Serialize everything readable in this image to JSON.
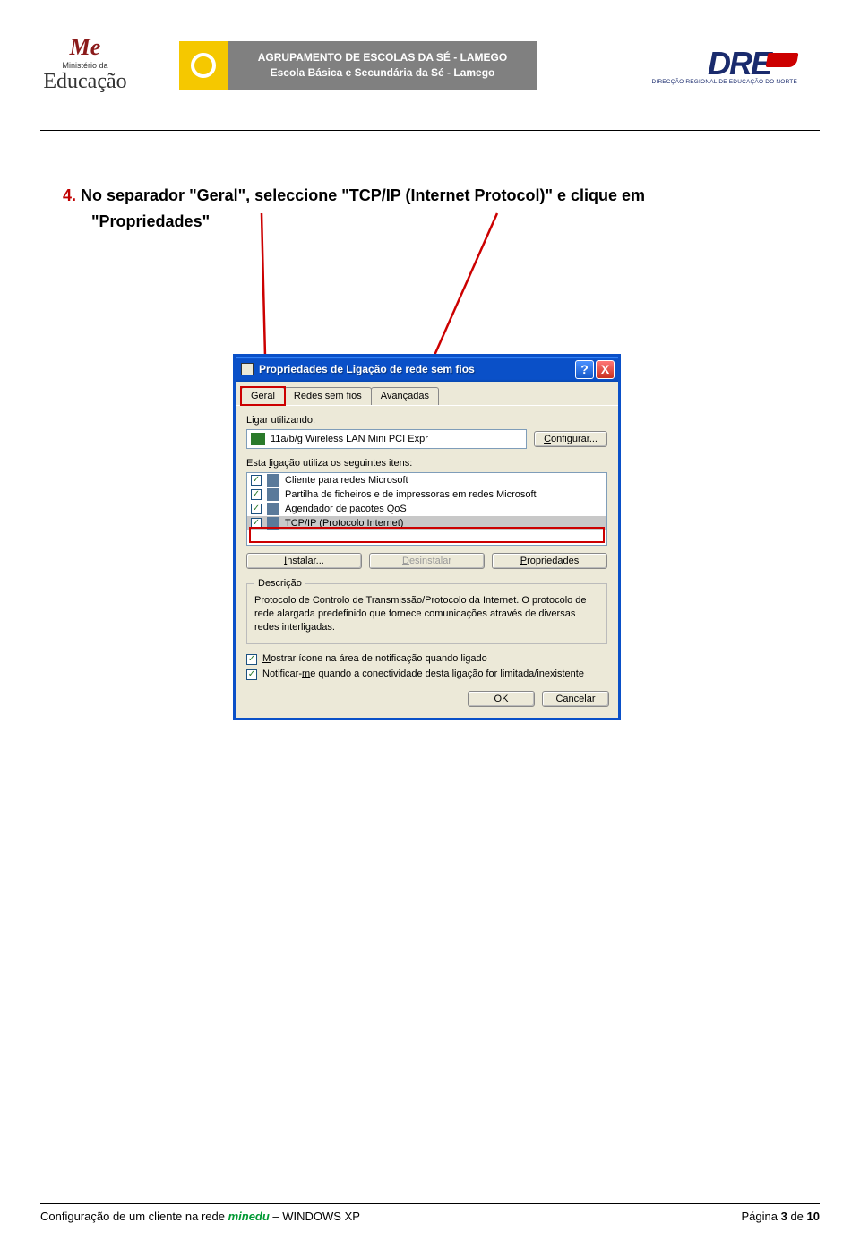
{
  "header": {
    "me_top": "Me",
    "me_mid": "Ministério da",
    "me_bot": "Educação",
    "banner_line1": "AGRUPAMENTO DE ESCOLAS DA SÉ - LAMEGO",
    "banner_line2": "Escola Básica e Secundária da Sé - Lamego",
    "dren_main": "DRE",
    "dren_sub": "DIRECÇÃO REGIONAL DE EDUCAÇÃO DO NORTE"
  },
  "step": {
    "num": "4.",
    "text_before": " No separador ",
    "geral_q": "\"Geral\"",
    "text_mid1": ", seleccione ",
    "tcp_q": "\"TCP/IP (Internet Protocol)\"",
    "text_mid2": " e clique em",
    "prop_q": "\"Propriedades\""
  },
  "dialog": {
    "title": "Propriedades de Ligação de rede sem fios",
    "help": "?",
    "close": "X",
    "tabs": {
      "geral": "Geral",
      "redes": "Redes sem fios",
      "avancadas": "Avançadas"
    },
    "ligar_label": "Ligar utilizando:",
    "adapter": "11a/b/g Wireless LAN Mini PCI Expr",
    "configurar": "Configurar...",
    "items_label": "Esta ligação utiliza os seguintes itens:",
    "items": [
      {
        "checked": true,
        "label": "Cliente para redes Microsoft"
      },
      {
        "checked": true,
        "label": "Partilha de ficheiros e de impressoras em redes Microsoft"
      },
      {
        "checked": true,
        "label": "Agendador de pacotes QoS"
      },
      {
        "checked": true,
        "label": "TCP/IP (Protocolo Internet)",
        "selected": true
      }
    ],
    "instalar": "Instalar...",
    "desinstalar": "Desinstalar",
    "propriedades": "Propriedades",
    "desc_legend": "Descrição",
    "desc_text": "Protocolo de Controlo de Transmissão/Protocolo da Internet. O protocolo de rede alargada predefinido que fornece comunicações através de diversas redes interligadas.",
    "chk1": "Mostrar ícone na área de notificação quando ligado",
    "chk2": "Notificar-me quando a conectividade desta ligação for limitada/inexistente",
    "ok": "OK",
    "cancel": "Cancelar"
  },
  "footer": {
    "left_a": "Configuração de um cliente na rede ",
    "minedu": "minedu",
    "left_b": " – WINDOWS XP",
    "right_a": "Página ",
    "page": "3",
    "right_b": " de ",
    "total": "10"
  }
}
